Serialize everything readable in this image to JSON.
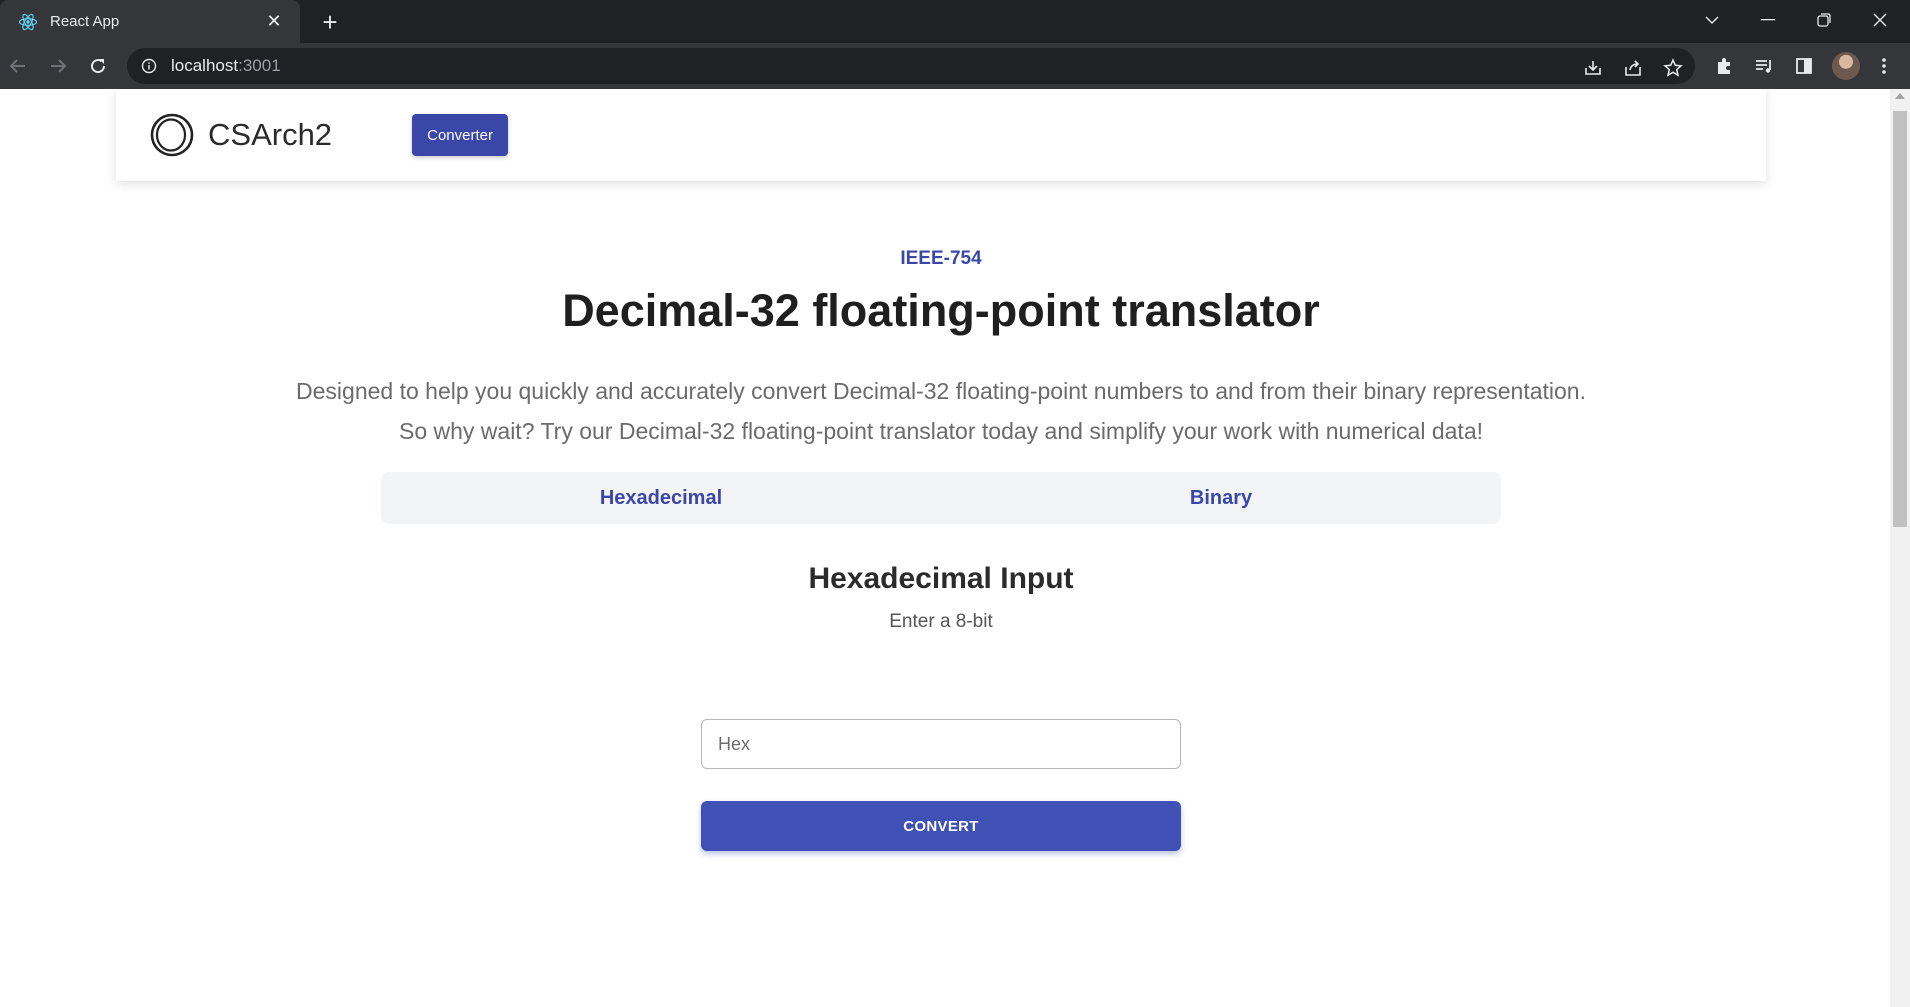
{
  "browser": {
    "tab_title": "React App",
    "url_host": "localhost",
    "url_port": ":3001"
  },
  "header": {
    "brand": "CSArch2",
    "nav_button": "Converter"
  },
  "hero": {
    "kicker": "IEEE-754",
    "title": "Decimal-32 floating-point translator",
    "description_line1": "Designed to help you quickly and accurately convert Decimal-32 floating-point numbers to and from their binary representation.",
    "description_line2": "So why wait? Try our Decimal-32 floating-point translator today and simplify your work with numerical data!"
  },
  "mode_tabs": [
    {
      "label": "Hexadecimal"
    },
    {
      "label": "Binary"
    }
  ],
  "form": {
    "title": "Hexadecimal Input",
    "subtitle": "Enter a 8-bit",
    "input_placeholder": "Hex",
    "input_value": "",
    "convert_label": "CONVERT"
  },
  "colors": {
    "accent": "#3b47a8",
    "button": "#3f51b5"
  }
}
